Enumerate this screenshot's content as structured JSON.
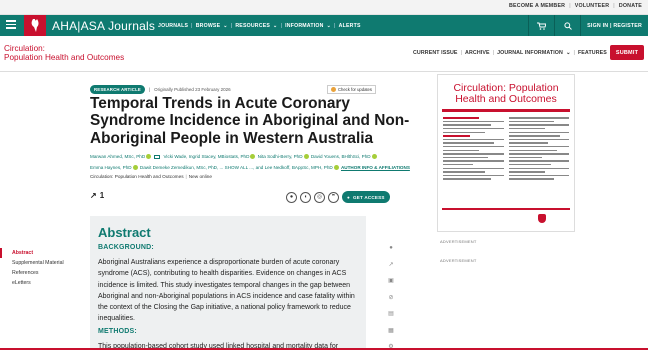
{
  "utility": {
    "become_member": "BECOME A MEMBER",
    "volunteer": "VOLUNTEER",
    "donate": "DONATE",
    "sep": "|"
  },
  "nav": {
    "brand": "AHA|ASA Journals",
    "journals": "JOURNALS",
    "browse": "BROWSE",
    "resources": "RESOURCES",
    "information": "INFORMATION",
    "alerts": "ALERTS",
    "sign_in": "SIGN IN | REGISTER",
    "sep": "|",
    "chevron": "⌄"
  },
  "journal": {
    "name_line1": "Circulation:",
    "name_line2": "Population Health and Outcomes",
    "current_issue": "CURRENT ISSUE",
    "archive": "ARCHIVE",
    "journal_information": "JOURNAL INFORMATION",
    "features": "FEATURES",
    "submit": "SUBMIT",
    "sep": "|",
    "chevron": "⌄"
  },
  "article": {
    "badge": "RESEARCH ARTICLE",
    "sep": "|",
    "published": "Originally Published 23 February 2026",
    "check_updates": "Check for updates",
    "title": "Temporal Trends in Acute Coronary Syndrome Incidence in Aboriginal and Non-Aboriginal People in Western Australia",
    "author_a1": "Marwan Ahmed, MSc, PhD",
    "author_a2": "Vicki Wade, Ingrid Stacey, MBiostats, PhD",
    "author_a3": "Nita Sodhi-Berry, PhD",
    "author_a4": "David Youens, BHlthSci, PhD",
    "author_b1": "Emma Haynes, PhD",
    "author_b2": "Dawit Demeke Zemedikun, MSc, PhD, ...",
    "show_all": "SHOW ALL",
    "author_b3": "..., and Lee Nedkoff, BAppSc, MPH, PhD",
    "author_info": "AUTHOR INFO & AFFILIATIONS",
    "journal_line": "Circulation: Population Health and Outcomes",
    "new_online": "New online",
    "metric_icon": "trend-arrow",
    "metric_glyph": "↗",
    "metric_count": "1",
    "get_access": "GET ACCESS"
  },
  "rail": {
    "items": [
      "Abstract",
      "Supplemental Material",
      "References",
      "eLetters"
    ]
  },
  "abstract": {
    "heading": "Abstract",
    "background_heading": "BACKGROUND:",
    "background_text": "Aboriginal Australians experience a disproportionate burden of acute coronary syndrome (ACS), contributing to health disparities. Evidence on changes in ACS incidence is limited. This study investigates temporal changes in the gap between Aboriginal and non-Aboriginal populations in ACS incidence and case fatality within the context of the Closing the Gap initiative, a national policy framework to reduce inequalities.",
    "methods_heading": "METHODS:",
    "methods_text": "This population-based cohort study used linked hospital and mortality data for"
  },
  "cover": {
    "title": "Circulation: Population Health and Outcomes"
  },
  "ads": {
    "label1": "ADVERTISEMENT",
    "label2": "ADVERTISEMENT"
  },
  "colors": {
    "teal": "#0f7a70",
    "red": "#c8102e"
  }
}
